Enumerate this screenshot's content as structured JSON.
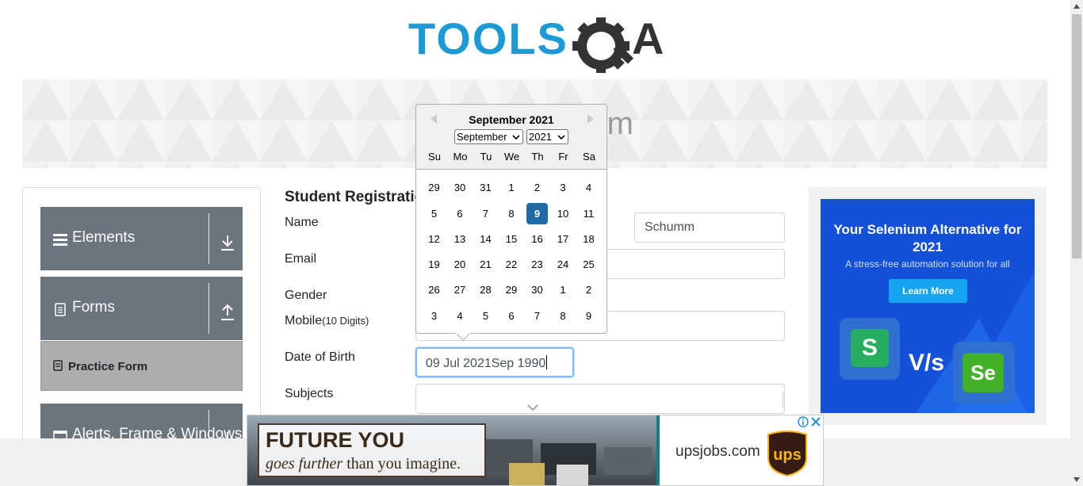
{
  "header": {
    "logo_text": "TOOLSQA"
  },
  "banner": {
    "title": "Practice Form"
  },
  "sidebar": {
    "groups": [
      {
        "label": "Elements"
      },
      {
        "label": "Forms",
        "items": [
          {
            "label": "Practice Form"
          }
        ]
      },
      {
        "label": "Alerts, Frame & Windows"
      }
    ]
  },
  "form": {
    "title": "Student Registration Form",
    "fields": {
      "name": {
        "label": "Name",
        "last_name_value": "Schumm"
      },
      "email": {
        "label": "Email"
      },
      "gender": {
        "label": "Gender"
      },
      "mobile": {
        "label": "Mobile",
        "hint": "(10 Digits)"
      },
      "dob": {
        "label": "Date of Birth",
        "value": "09 Jul 2021Sep 1990"
      },
      "subjects": {
        "label": "Subjects"
      }
    }
  },
  "datepicker": {
    "header": "September 2021",
    "month_select": "September",
    "year_select": "2021",
    "weekdays": [
      "Su",
      "Mo",
      "Tu",
      "We",
      "Th",
      "Fr",
      "Sa"
    ],
    "weeks": [
      [
        "29",
        "30",
        "31",
        "1",
        "2",
        "3",
        "4"
      ],
      [
        "5",
        "6",
        "7",
        "8",
        "9",
        "10",
        "11"
      ],
      [
        "12",
        "13",
        "14",
        "15",
        "16",
        "17",
        "18"
      ],
      [
        "19",
        "20",
        "21",
        "22",
        "23",
        "24",
        "25"
      ],
      [
        "26",
        "27",
        "28",
        "29",
        "30",
        "1",
        "2"
      ],
      [
        "3",
        "4",
        "5",
        "6",
        "7",
        "8",
        "9"
      ]
    ],
    "selected_day": "9",
    "selected_color": "#216ba5"
  },
  "right_ad": {
    "headline": "Your Selenium Alternative for 2021",
    "subtext": "A stress-free automation solution for all",
    "button": "Learn More",
    "vs_text": "V/s",
    "se_text": "Se",
    "s_text": "S"
  },
  "bottom_ad": {
    "line1": "FUTURE YOU",
    "line2_italic": "goes further",
    "line2_rest": " than you imagine.",
    "url": "upsjobs.com",
    "logo_text": "ups"
  },
  "colors": {
    "brand_blue": "#1b9ad6",
    "sidebar_gray": "#6c757d",
    "active_item": "#adadad"
  }
}
